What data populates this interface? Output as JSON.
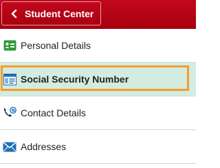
{
  "header": {
    "back_label": "Student Center",
    "icon": "chevron-left-icon",
    "colors": {
      "bar": "#b2001a",
      "text": "#ffffff"
    }
  },
  "nav": {
    "items": [
      {
        "label": "Personal Details",
        "icon": "id-card-icon",
        "active": false
      },
      {
        "label": "Social Security Number",
        "icon": "form-table-icon",
        "active": true
      },
      {
        "label": "Contact Details",
        "icon": "phone-email-icon",
        "active": false
      },
      {
        "label": "Addresses",
        "icon": "envelope-icon",
        "active": false
      }
    ],
    "colors": {
      "active_bg": "#d3ece0",
      "focus_ring": "#f59b2a"
    }
  }
}
